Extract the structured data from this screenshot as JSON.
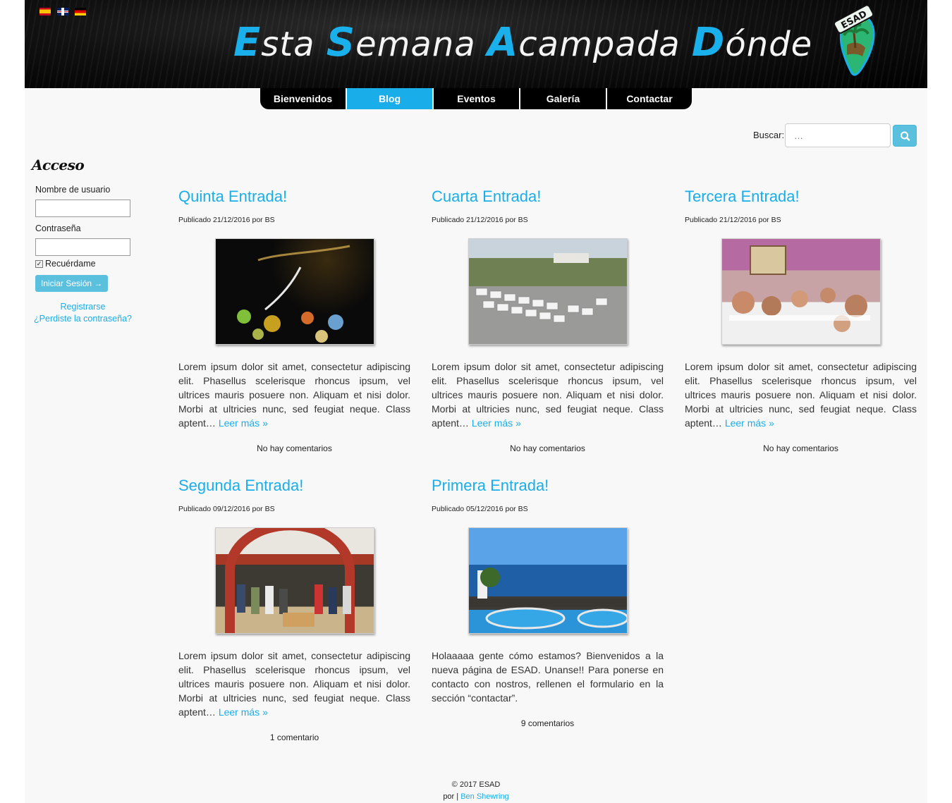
{
  "header": {
    "languages": [
      {
        "name": "flag-spain-icon",
        "colors": [
          "#c60b1e",
          "#ffc400"
        ]
      },
      {
        "name": "flag-uk-icon",
        "colors": [
          "#012169",
          "#ffffff",
          "#c8102e"
        ]
      },
      {
        "name": "flag-germany-icon",
        "colors": [
          "#000000",
          "#dd0000",
          "#ffce00"
        ]
      }
    ],
    "title_words": [
      {
        "cap": "E",
        "rest": "sta"
      },
      {
        "cap": "S",
        "rest": "emana"
      },
      {
        "cap": "A",
        "rest": "campada"
      },
      {
        "cap": "D",
        "rest": "ónde"
      }
    ],
    "logo_text": "ESAD"
  },
  "nav": {
    "items": [
      {
        "label": "Bienvenidos",
        "active": false
      },
      {
        "label": "Blog",
        "active": true
      },
      {
        "label": "Eventos",
        "active": false
      },
      {
        "label": "Galería",
        "active": false
      },
      {
        "label": "Contactar",
        "active": false
      }
    ]
  },
  "search": {
    "label": "Buscar:",
    "placeholder": "…",
    "button_icon": "search-icon"
  },
  "login": {
    "title": "Acceso",
    "username_label": "Nombre de usuario",
    "password_label": "Contraseña",
    "remember_label": "Recuérdame",
    "remember_checked": true,
    "submit_label": "Iniciar Sesión →",
    "register_link": "Registrarse",
    "forgot_link": "¿Perdiste la contraseña?"
  },
  "posts": [
    {
      "title": "Quinta Entrada!",
      "meta": "Publicado 21/12/2016 por BS",
      "excerpt": "Lorem ipsum dolor sit amet, consectetur adipiscing elit. Phasellus scelerisque rhoncus ipsum, vel ultrices mauris posuere non. Aliquam et nisi dolor. Morbi at ultricies nunc, sed feugiat neque. Class aptent…",
      "read_more": "Leer más »",
      "comments": "No hay comentarios"
    },
    {
      "title": "Cuarta Entrada!",
      "meta": "Publicado 21/12/2016 por BS",
      "excerpt": "Lorem ipsum dolor sit amet, consectetur adipiscing elit. Phasellus scelerisque rhoncus ipsum, vel ultrices mauris posuere non. Aliquam et nisi dolor. Morbi at ultricies nunc, sed feugiat neque. Class aptent…",
      "read_more": "Leer más »",
      "comments": "No hay comentarios"
    },
    {
      "title": "Tercera Entrada!",
      "meta": "Publicado 21/12/2016 por BS",
      "excerpt": "Lorem ipsum dolor sit amet, consectetur adipiscing elit. Phasellus scelerisque rhoncus ipsum, vel ultrices mauris posuere non. Aliquam et nisi dolor. Morbi at ultricies nunc, sed feugiat neque. Class aptent…",
      "read_more": "Leer más »",
      "comments": "No hay comentarios"
    },
    {
      "title": "Segunda Entrada!",
      "meta": "Publicado 09/12/2016 por BS",
      "excerpt": "Lorem ipsum dolor sit amet, consectetur adipiscing elit. Phasellus scelerisque rhoncus ipsum, vel ultrices mauris posuere non. Aliquam et nisi dolor. Morbi at ultricies nunc, sed feugiat neque. Class aptent…",
      "read_more": "Leer más »",
      "comments": "1 comentario"
    },
    {
      "title": "Primera Entrada!",
      "meta": "Publicado 05/12/2016 por BS",
      "excerpt": "Holaaaaa gente cómo estamos? Bienvenidos a la nueva página de ESAD. Unanse!! Para ponerse en contacto con nostros, rellenen el formulario en la sección “contactar”.",
      "read_more": "",
      "comments": "9 comentarios"
    }
  ],
  "footer": {
    "copyright": "© 2017 ESAD",
    "credit_prefix": "por |",
    "credit_link": "Ben Shewring"
  },
  "colors": {
    "accent": "#19aeea",
    "button": "#5bc0de",
    "header_bg": "#000000"
  }
}
